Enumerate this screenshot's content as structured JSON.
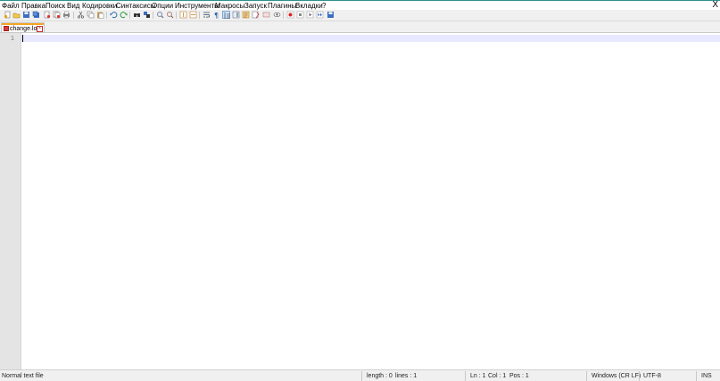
{
  "menu": {
    "items": [
      "Файл",
      "Правка",
      "Поиск",
      "Вид",
      "Кодировки",
      "Синтаксисы",
      "Опции",
      "Инструменты",
      "Макросы",
      "Запуск",
      "Плагины",
      "Вкладки",
      "?"
    ],
    "close": "X"
  },
  "toolbar": {
    "icons": [
      "new-file-icon",
      "open-file-icon",
      "save-icon",
      "save-all-icon",
      "close-icon",
      "close-all-icon",
      "print-icon",
      "cut-icon",
      "copy-icon",
      "paste-icon",
      "undo-icon",
      "redo-icon",
      "find-icon",
      "replace-icon",
      "zoom-in-icon",
      "zoom-out-icon",
      "sync-vertical-icon",
      "sync-horizontal-icon",
      "word-wrap-icon",
      "show-all-chars-icon",
      "indent-guide-icon",
      "document-map-icon",
      "function-list-icon",
      "folder-workspace-icon",
      "document-list-icon",
      "monitor-icon",
      "record-macro-icon",
      "stop-record-icon",
      "play-macro-icon",
      "play-multiple-icon",
      "save-macro-icon"
    ]
  },
  "tabs": [
    {
      "label": "change.log",
      "close": "×"
    }
  ],
  "editor": {
    "line_numbers": [
      "1"
    ]
  },
  "status": {
    "file_type": "Normal text file",
    "length": "length : 0",
    "lines": "lines : 1",
    "ln": "Ln : 1",
    "col": "Col : 1",
    "pos": "Pos : 1",
    "eol": "Windows (CR LF)",
    "encoding": "UTF-8",
    "mode": "INS"
  },
  "colors": {
    "tab_accent": "#f5a623",
    "current_line": "#e8e8ff",
    "close_red": "#c03030"
  }
}
